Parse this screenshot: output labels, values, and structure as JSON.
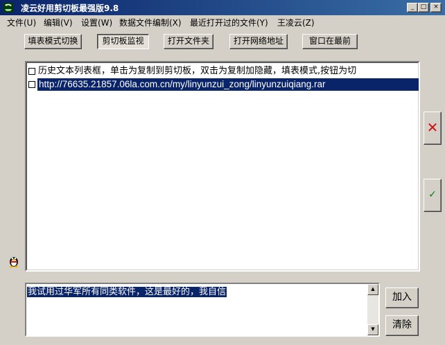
{
  "window": {
    "title": "凌云好用剪切板最强版9.8",
    "controls": {
      "minimize": "_",
      "maximize": "□",
      "close": "×"
    }
  },
  "menu": [
    "文件(U)",
    "编辑(V)",
    "设置(W)",
    "数据文件编制(X)",
    "最近打开过的文件(Y)",
    "王凌云(Z)"
  ],
  "toolbar": [
    {
      "label": "填表模式切换",
      "pressed": false
    },
    {
      "label": "剪切板监视",
      "pressed": true
    },
    {
      "label": "打开文件夹",
      "pressed": false
    },
    {
      "label": "打开网络地址",
      "pressed": false
    },
    {
      "label": "窗口在最前",
      "pressed": false
    }
  ],
  "history_list": [
    {
      "text": "历史文本列表框，单击为复制到剪切板，双击为复制加隐藏，填表模式,按钮为切",
      "selected": false
    },
    {
      "text": "http://76635.21857.06la.com.cn/my/linyunzui_zong/linyunzuiqiang.rar",
      "selected": true
    }
  ],
  "side_buttons": {
    "delete_icon": "✕",
    "confirm_icon": "✓"
  },
  "icons": {
    "app": "app-icon",
    "qq": "qq-penguin-icon"
  },
  "input_text": "我试用过华军所有同类软件，这是最好的，我自信",
  "scroll_arrows": {
    "up": "▲",
    "down": "▼"
  },
  "actions": {
    "add": "加入",
    "clear": "清除"
  },
  "colors": {
    "titlebar": "#0a246a",
    "selection": "#0a246a",
    "delete": "#d01010",
    "confirm": "#0a7a0a",
    "face": "#d4d0c8"
  }
}
